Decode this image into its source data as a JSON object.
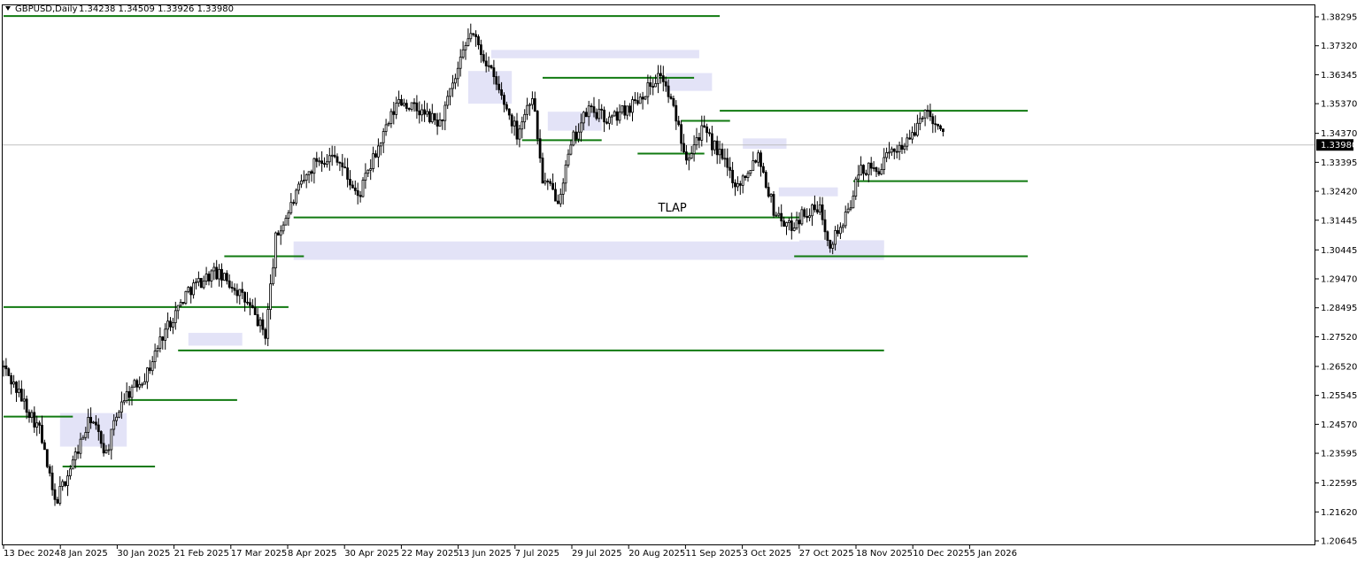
{
  "header": {
    "symbol": "GBPUSD,Daily",
    "ohlc": "1.34238 1.34509 1.33926 1.33980",
    "menu_icon": "triangle-down-icon"
  },
  "current_price_label": "1.33980",
  "colors": {
    "candle": "#000000",
    "level_line": "#117a11",
    "zone": "#e3e3f7",
    "price_tag_bg": "#000000",
    "current_price_line": "#c0c0c0",
    "grid": "none"
  },
  "chart_data": {
    "type": "candlestick",
    "title": "GBPUSD,Daily",
    "grid": false,
    "ylim": [
      1.2015,
      1.387
    ],
    "y_ticks": [
      "1.38295",
      "1.37320",
      "1.36345",
      "1.35370",
      "1.34370",
      "1.33395",
      "1.32420",
      "1.31445",
      "1.30445",
      "1.29470",
      "1.28495",
      "1.27520",
      "1.26520",
      "1.25545",
      "1.24570",
      "1.23595",
      "1.22595",
      "1.21620",
      "1.20645"
    ],
    "x_labels": [
      "13 Dec 2024",
      "8 Jan 2025",
      "30 Jan 2025",
      "21 Feb 2025",
      "17 Mar 2025",
      "8 Apr 2025",
      "30 Apr 2025",
      "22 May 2025",
      "13 Jun 2025",
      "7 Jul 2025",
      "29 Jul 2025",
      "20 Aug 2025",
      "11 Sep 2025",
      "3 Oct 2025",
      "27 Oct 2025",
      "18 Nov 2025",
      "10 Dec 2025",
      "5 Jan 2026"
    ],
    "anchors": [
      [
        0,
        1.265
      ],
      [
        8,
        1.253
      ],
      [
        14,
        1.244
      ],
      [
        20,
        1.219
      ],
      [
        26,
        1.231
      ],
      [
        34,
        1.248
      ],
      [
        40,
        1.236
      ],
      [
        46,
        1.254
      ],
      [
        56,
        1.263
      ],
      [
        62,
        1.276
      ],
      [
        72,
        1.291
      ],
      [
        82,
        1.297
      ],
      [
        90,
        1.292
      ],
      [
        96,
        1.285
      ],
      [
        102,
        1.276
      ],
      [
        106,
        1.308
      ],
      [
        114,
        1.323
      ],
      [
        122,
        1.335
      ],
      [
        130,
        1.336
      ],
      [
        138,
        1.322
      ],
      [
        146,
        1.339
      ],
      [
        154,
        1.355
      ],
      [
        162,
        1.351
      ],
      [
        170,
        1.347
      ],
      [
        176,
        1.362
      ],
      [
        182,
        1.378
      ],
      [
        188,
        1.368
      ],
      [
        194,
        1.356
      ],
      [
        200,
        1.344
      ],
      [
        206,
        1.357
      ],
      [
        210,
        1.328
      ],
      [
        216,
        1.322
      ],
      [
        222,
        1.342
      ],
      [
        228,
        1.352
      ],
      [
        236,
        1.348
      ],
      [
        244,
        1.353
      ],
      [
        250,
        1.358
      ],
      [
        256,
        1.364
      ],
      [
        262,
        1.349
      ],
      [
        266,
        1.336
      ],
      [
        272,
        1.345
      ],
      [
        278,
        1.338
      ],
      [
        286,
        1.326
      ],
      [
        294,
        1.337
      ],
      [
        300,
        1.318
      ],
      [
        306,
        1.312
      ],
      [
        312,
        1.317
      ],
      [
        318,
        1.318
      ],
      [
        322,
        1.307
      ],
      [
        328,
        1.315
      ],
      [
        334,
        1.332
      ],
      [
        340,
        1.331
      ],
      [
        348,
        1.339
      ],
      [
        354,
        1.342
      ],
      [
        358,
        1.351
      ],
      [
        362,
        1.349
      ],
      [
        366,
        1.343
      ]
    ],
    "candles_count": 367,
    "levels": [
      {
        "price": 1.3832,
        "from": 0,
        "to": 279
      },
      {
        "price": 1.3513,
        "from": 279,
        "to": 399
      },
      {
        "price": 1.3276,
        "from": 331,
        "to": 399
      },
      {
        "price": 1.3154,
        "from": 113,
        "to": 310
      },
      {
        "price": 1.3023,
        "from": 86,
        "to": 117
      },
      {
        "price": 1.3023,
        "from": 308,
        "to": 399
      },
      {
        "price": 1.2852,
        "from": 0,
        "to": 111
      },
      {
        "price": 1.2706,
        "from": 68,
        "to": 343
      },
      {
        "price": 1.2539,
        "from": 48,
        "to": 91
      },
      {
        "price": 1.2483,
        "from": 0,
        "to": 27
      },
      {
        "price": 1.2315,
        "from": 23,
        "to": 59
      },
      {
        "price": 1.3624,
        "from": 210,
        "to": 269
      },
      {
        "price": 1.3414,
        "from": 202,
        "to": 233
      },
      {
        "price": 1.3369,
        "from": 247,
        "to": 273
      },
      {
        "price": 1.3479,
        "from": 264,
        "to": 283
      }
    ],
    "zones": [
      {
        "from": 22,
        "to": 48,
        "low": 1.2382,
        "high": 1.2495
      },
      {
        "from": 72,
        "to": 93,
        "low": 1.2722,
        "high": 1.2765
      },
      {
        "from": 113,
        "to": 343,
        "low": 1.3011,
        "high": 1.3073
      },
      {
        "from": 181,
        "to": 198,
        "low": 1.3537,
        "high": 1.3647
      },
      {
        "from": 190,
        "to": 271,
        "low": 1.369,
        "high": 1.3718
      },
      {
        "from": 212,
        "to": 233,
        "low": 1.3446,
        "high": 1.351
      },
      {
        "from": 258,
        "to": 276,
        "low": 1.358,
        "high": 1.364
      },
      {
        "from": 288,
        "to": 305,
        "low": 1.3385,
        "high": 1.342
      },
      {
        "from": 302,
        "to": 325,
        "low": 1.3225,
        "high": 1.3255
      },
      {
        "from": 310,
        "to": 343,
        "low": 1.305,
        "high": 1.3077
      }
    ],
    "annotations": [
      {
        "text": "TLAP",
        "x": 255,
        "y": 1.3174
      }
    ]
  }
}
